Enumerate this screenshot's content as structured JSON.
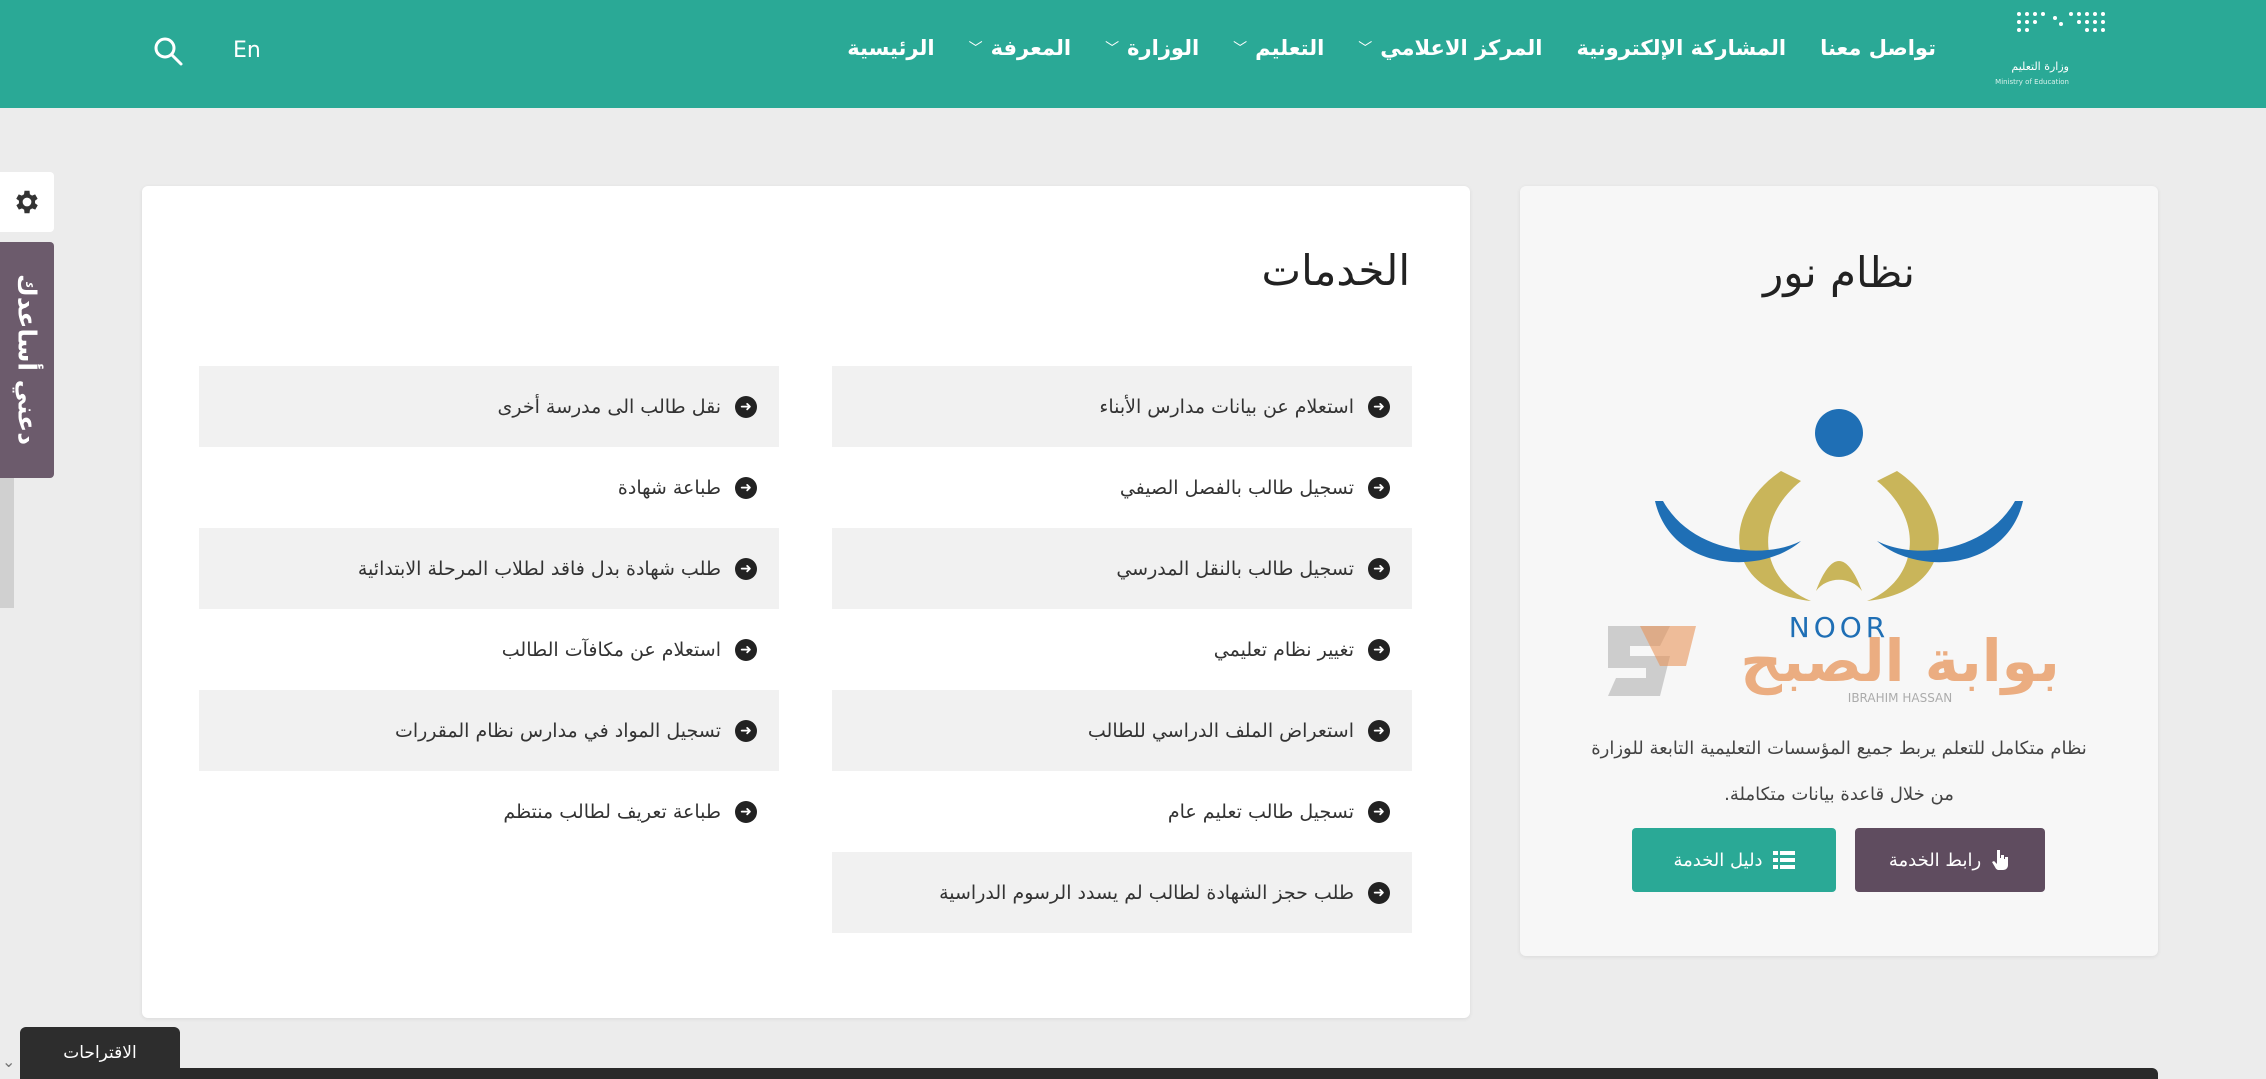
{
  "header": {
    "logo_text": "وزارة التعليم",
    "logo_sub": "Ministry of Education",
    "nav": [
      {
        "label": "الرئيسية",
        "dropdown": false
      },
      {
        "label": "المعرفة",
        "dropdown": true
      },
      {
        "label": "الوزارة",
        "dropdown": true
      },
      {
        "label": "التعليم",
        "dropdown": true
      },
      {
        "label": "المركز الاعلامي",
        "dropdown": true
      },
      {
        "label": "المشاركة الإلكترونية",
        "dropdown": false
      },
      {
        "label": "تواصل معنا",
        "dropdown": false
      }
    ],
    "chevron": "﹀",
    "lang": "En",
    "search_icon": "search-icon"
  },
  "side": {
    "help_label": "دعني أساعدك",
    "gear_icon": "gear-icon"
  },
  "services": {
    "title": "الخدمات",
    "right_column": [
      "استعلام عن بيانات مدارس الأبناء",
      "تسجيل طالب بالفصل الصيفي",
      "تسجيل طالب بالنقل المدرسي",
      "تغيير نظام تعليمي",
      "استعراض الملف الدراسي للطالب",
      "تسجيل طالب تعليم عام",
      "طلب حجز الشهادة لطالب لم يسدد الرسوم الدراسية"
    ],
    "left_column": [
      "نقل طالب الى مدرسة أخرى",
      "طباعة شهادة",
      "طلب شهادة بدل فاقد لطلاب المرحلة الابتدائية",
      "استعلام عن مكافآت الطالب",
      "تسجيل المواد في مدارس نظام المقررات",
      "طباعة تعريف لطالب منتظم"
    ],
    "arrow_glyph": "➜"
  },
  "noor": {
    "title": "نظام نور",
    "logo_text": "NOOR",
    "watermark_text": "بوابة الصبح",
    "watermark_sub": "IBRAHIM HASSAN",
    "description": "نظام متكامل للتعلم يربط جميع المؤسسات التعليمية التابعة للوزارة من خلال قاعدة بيانات متكاملة.",
    "link_button": "رابط الخدمة",
    "guide_button": "دليل الخدمة",
    "colors": {
      "blue": "#1f6fb5",
      "gold": "#c9b55a",
      "link_btn": "#5f4c5f",
      "guide_btn": "#2aa996"
    }
  },
  "footer": {
    "suggestions_tab": "الاقتراحات",
    "corner_chevron": "⌄"
  },
  "theme": {
    "primary": "#2aa996"
  }
}
